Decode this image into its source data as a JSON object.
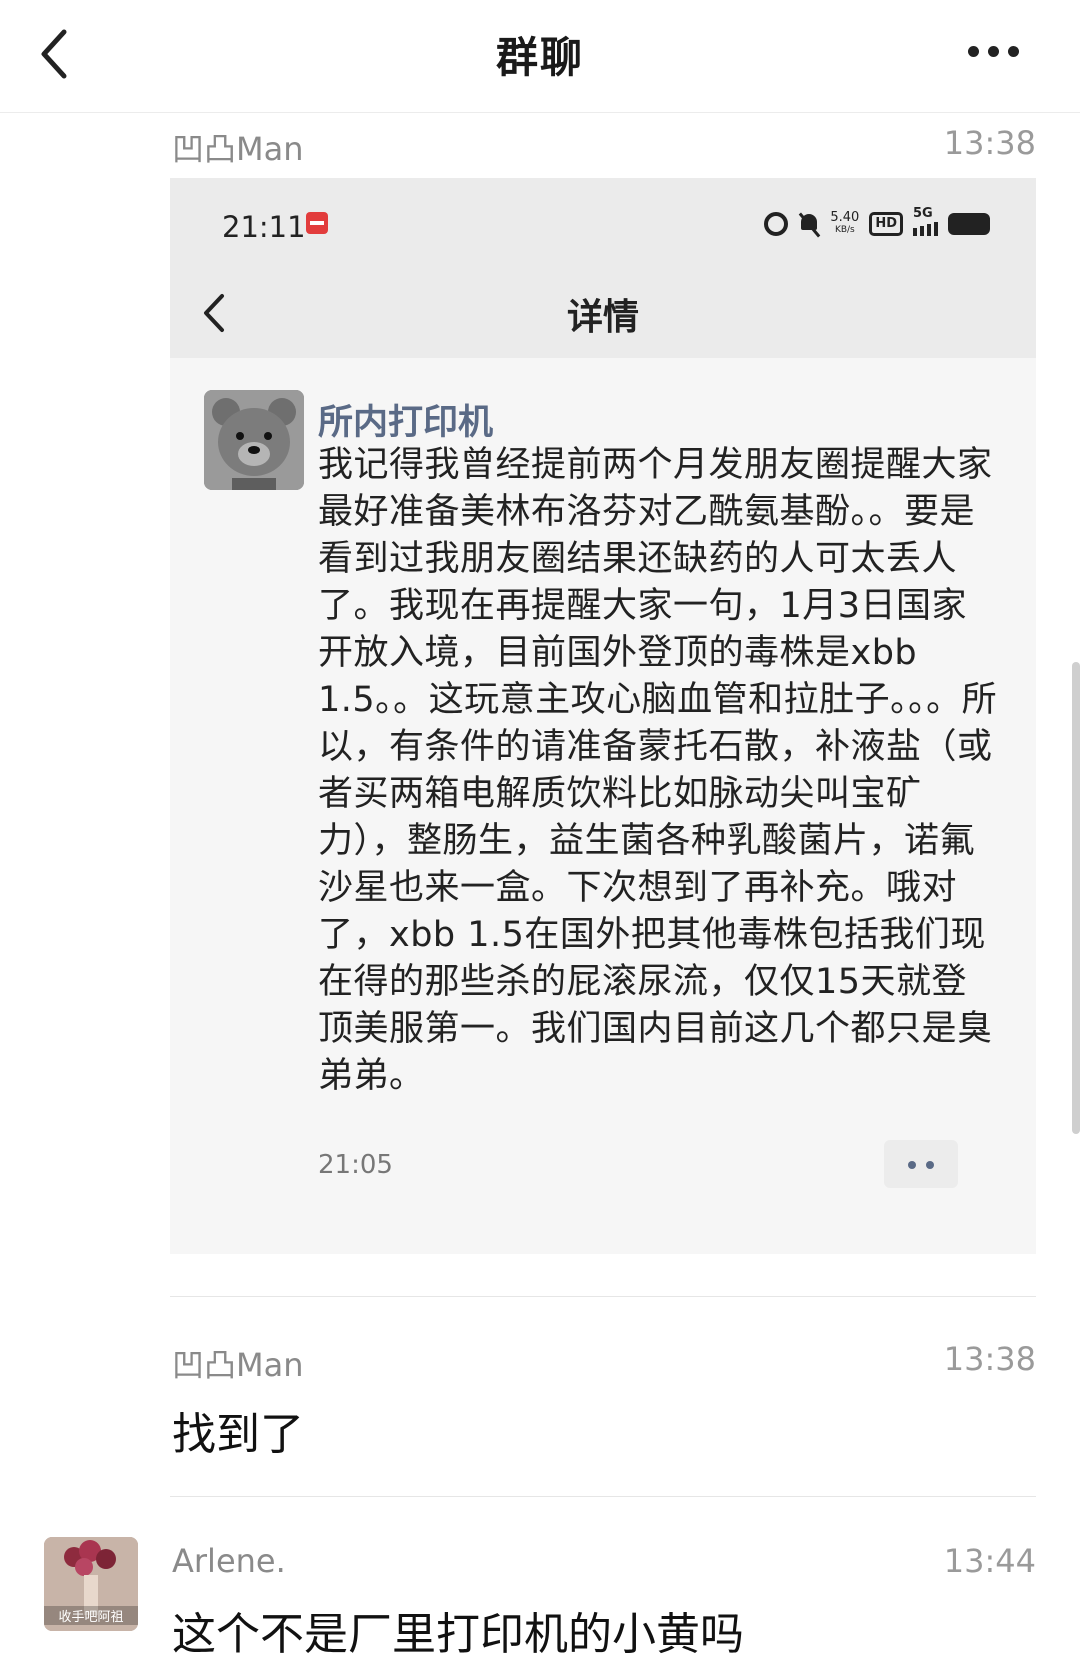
{
  "header": {
    "title": "群聊"
  },
  "messages": [
    {
      "sender": "凹凸Man",
      "time": "13:38",
      "screenshot": {
        "status_time": "21:11",
        "speed": "5.40",
        "speed_unit": "KB/s",
        "hd": "HD",
        "network": "5G",
        "title": "详情",
        "post_author": "所内打印机",
        "post_text": "我记得我曾经提前两个月发朋友圈提醒大家最好准备美林布洛芬对乙酰氨基酚。。要是看到过我朋友圈结果还缺药的人可太丢人了。我现在再提醒大家一句，1月3日国家开放入境，目前国外登顶的毒株是xbb 1.5。。这玩意主攻心脑血管和拉肚子。。。所以，有条件的请准备蒙托石散，补液盐（或者买两箱电解质饮料比如脉动尖叫宝矿力），整肠生，益生菌各种乳酸菌片，诺氟沙星也来一盒。下次想到了再补充。哦对了，xbb 1.5在国外把其他毒株包括我们现在得的那些杀的屁滚尿流，仅仅15天就登顶美服第一。我们国内目前这几个都只是臭弟弟。",
        "post_time": "21:05"
      }
    },
    {
      "sender": "凹凸Man",
      "time": "13:38",
      "text": "找到了"
    },
    {
      "sender": "Arlene.",
      "time": "13:44",
      "text": "这个不是厂里打印机的小黄吗",
      "avatar_caption": "收手吧阿祖"
    }
  ],
  "colors": {
    "accent_name": "#5a6a86",
    "background": "#ffffff"
  }
}
